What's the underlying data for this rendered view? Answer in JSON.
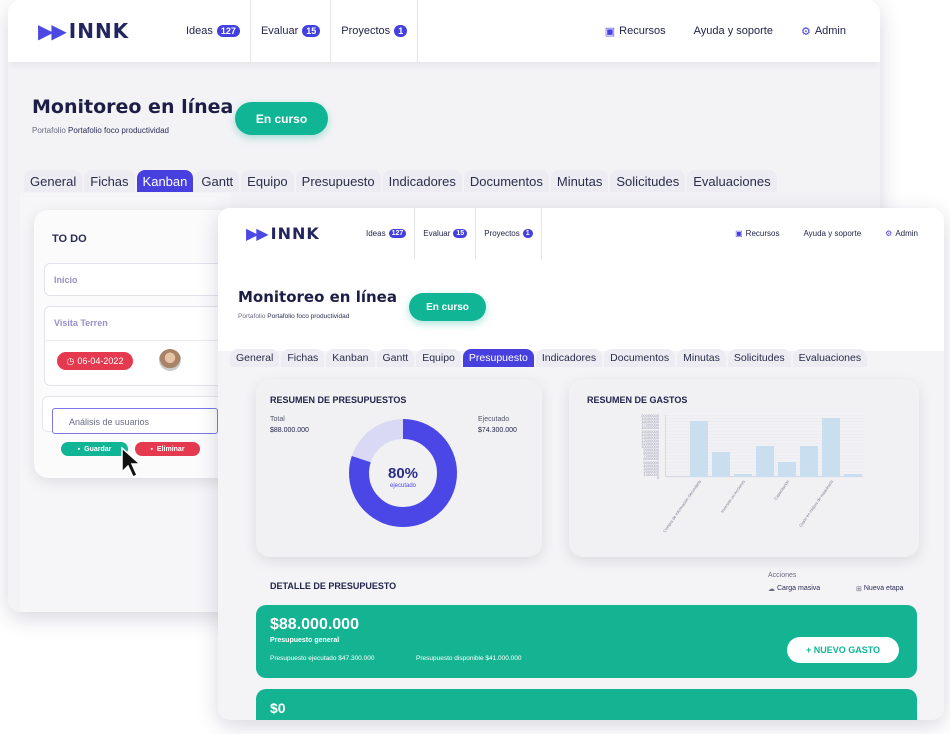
{
  "nav": {
    "brand": "INNK",
    "ideas": {
      "label": "Ideas",
      "count": "127"
    },
    "evaluar": {
      "label": "Evaluar",
      "count": "15"
    },
    "proyectos": {
      "label": "Proyectos",
      "count": "1"
    },
    "recursos": "Recursos",
    "ayuda": "Ayuda y soporte",
    "admin": "Admin"
  },
  "page": {
    "title": "Monitoreo en línea",
    "portfolio_label": "Portafolio",
    "portfolio_name": "Portafolio foco productividad",
    "status": "En curso"
  },
  "tabs": [
    "General",
    "Fichas",
    "Kanban",
    "Gantt",
    "Equipo",
    "Presupuesto",
    "Indicadores",
    "Documentos",
    "Minutas",
    "Solicitudes",
    "Evaluaciones"
  ],
  "back_active_tab": "Kanban",
  "front_active_tab": "Presupuesto",
  "kanban": {
    "column_title": "TO DO",
    "card1": "Inicio",
    "card2": "Visita Terren",
    "date": "06-04-2022",
    "input_value": "Análisis de usuarios",
    "save": "Guardar",
    "delete": "Eliminar"
  },
  "summary": {
    "title": "RESUMEN DE PRESUPUESTOS",
    "total_label": "Total",
    "total_value": "$88.000.000",
    "executed_label": "Ejecutado",
    "executed_value": "$74.300.000",
    "percent": "80%",
    "percent_label": "ejecutado",
    "percent_value": 0.8
  },
  "expenses": {
    "title": "RESUMEN DE GASTOS",
    "chart_data": {
      "type": "bar",
      "categories": [
        "Compra de información Secundaria",
        "Inversión en Acciones",
        "Capacitación",
        "Gasto en mejora de maquinaria"
      ],
      "values": [
        0,
        18000000,
        8000000,
        1000000,
        10000000,
        5000000,
        10000000,
        19000000,
        1000000
      ],
      "ylim": [
        0,
        20000000
      ],
      "yticks": [
        "20000000",
        "19000000",
        "18000000",
        "17000000",
        "16000000",
        "15000000",
        "14000000",
        "13000000",
        "12000000",
        "11000000",
        "10000000",
        "9000000",
        "8000000",
        "7000000",
        "6000000",
        "5000000",
        "4000000",
        "3000000",
        "2000000",
        "1000000",
        "0"
      ]
    }
  },
  "detail": {
    "title": "DETALLE DE PRESUPUESTO",
    "actions_label": "Acciones",
    "bulk": "Carga masiva",
    "new_stage": "Nueva etapa",
    "amount": "$88.000.000",
    "amount_label": "Presupuesto general",
    "executed": "Presupuesto ejecutado $47.300.000",
    "available": "Presupuesto disponible $41.000.000",
    "new_expense": "+ NUEVO GASTO",
    "second_amount": "$0"
  },
  "colors": {
    "accent": "#4740df",
    "teal": "#10b596",
    "red": "#e4394f",
    "navy": "#1d1e46"
  }
}
